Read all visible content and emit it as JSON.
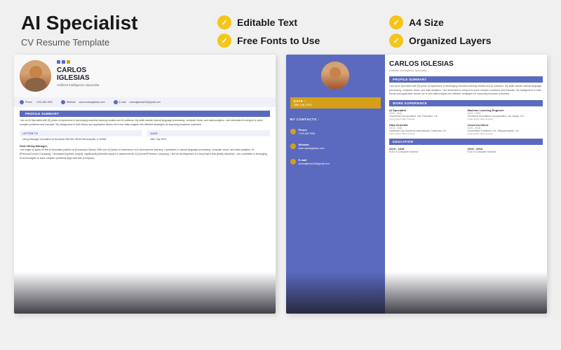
{
  "header": {
    "main_title": "AI Specialist",
    "subtitle": "CV Resume Template",
    "features": [
      {
        "id": "editable-text",
        "label": "Editable Text"
      },
      {
        "id": "a4-size",
        "label": "A4 Size"
      },
      {
        "id": "free-fonts",
        "label": "Free Fonts to Use"
      },
      {
        "id": "organized-layers",
        "label": "Organized Layers"
      }
    ]
  },
  "resume1": {
    "name_line1": "CARLOS",
    "name_line2": "IGLESIAS",
    "role": "Artificial Intelligence Specialist",
    "contact_phone_label": "Phone",
    "contact_phone": "+123-456-7890",
    "contact_website_label": "Website",
    "contact_website": "www.carlosiglesias.com",
    "contact_email_label": "E-mail",
    "contact_email": "carlosiglesias24@gmail.com",
    "profile_summary_label": "PROFILE SUMMARY",
    "profile_text": "I am an AI Specialist with [X] years of experience in developing machine learning models and AI solutions. My skills include natural language processing, computer vision, and data analytics. I am dedicated to using AI to solve complex problems and innovate. My background in both theory and application allows me to turn data insights into effective strategies for improving business outcomes.",
    "letter_label": "LETTER TO",
    "letter_to": "Hiring Manager\nInnovative AI Solutions\n456 Elm Street Minneapolis, IL 62960",
    "date_label": "DATE",
    "date_value": "28th July 2024",
    "dear_text": "Dear Hiring Manager,",
    "body_text": "I am eager to apply for the AI Specialist position at [Company's Name]. With over [X] years of experience in AI and machine learning, I specialize in natural language processing, computer vision, and data analytics. At [Previous/Current Company], I developed [specific project], significantly [describe impact or achievement]. At [Current/Previous Company], I led the development of a key project that [briefly describe]. I am committed in leveraging AI technologies to solve complex problems align well with [Company..."
  },
  "resume2": {
    "name": "CARLOS IGLESIAS",
    "role": "Artificial Intelligence Specialist",
    "date_label": "DATE :",
    "date_value": "28th July 2024",
    "contacts_label": "MY CONTACTS :",
    "phone_label": "Phone",
    "phone": "+123-456-7890",
    "website_label": "Website",
    "website": "www.carlosiglesias.com",
    "email_label": "E-mail",
    "email": "carlosiglesias24@gmail.com",
    "profile_label": "PROFILE SUMMARY",
    "profile_text": "I am an AI Specialist with [X] years of experience in developing machine learning models and AI solutions. My skills include natural language processing, computer vision, and data analytics. I am dedicated to using AI to solve complex problems and innovate. My background in both theory and application allows me to turn data insights into effective strategies for improving business outcomes.",
    "work_label": "WORK EXPERIENCE",
    "work_items": [
      {
        "title": "AI Specialist",
        "dates": "2022 - Now",
        "company": "CloudFlare Incorporated, San Francisco, CA",
        "desc": "Lorem ipsum dolor sit amet"
      },
      {
        "title": "Machine Learning Engineer",
        "dates": "2021 - 2022",
        "company": "TechNova Innovations Incorporated, Las Vegas, CA",
        "desc": "Lorem ipsum dolor sit amet"
      },
      {
        "title": "Data Scientist",
        "dates": "2018 - 2021",
        "company": "QuantumCorp Solutions International, California, CA",
        "desc": "Lorem ipsum dolor sit amet"
      },
      {
        "title": "Cloud Architect",
        "dates": "2015 - 2018",
        "company": "CornerWare Solutions Ltd., Massachusetts, CA",
        "desc": "Lorem ipsum dolor sit amet"
      }
    ],
    "education_label": "EDUCATION",
    "education_items": [
      {
        "degree": "2015 - 2018",
        "school": "M.Sc in Computer Science"
      },
      {
        "degree": "2015 - 2018",
        "school": "B.Sc in Computer Science"
      }
    ]
  }
}
